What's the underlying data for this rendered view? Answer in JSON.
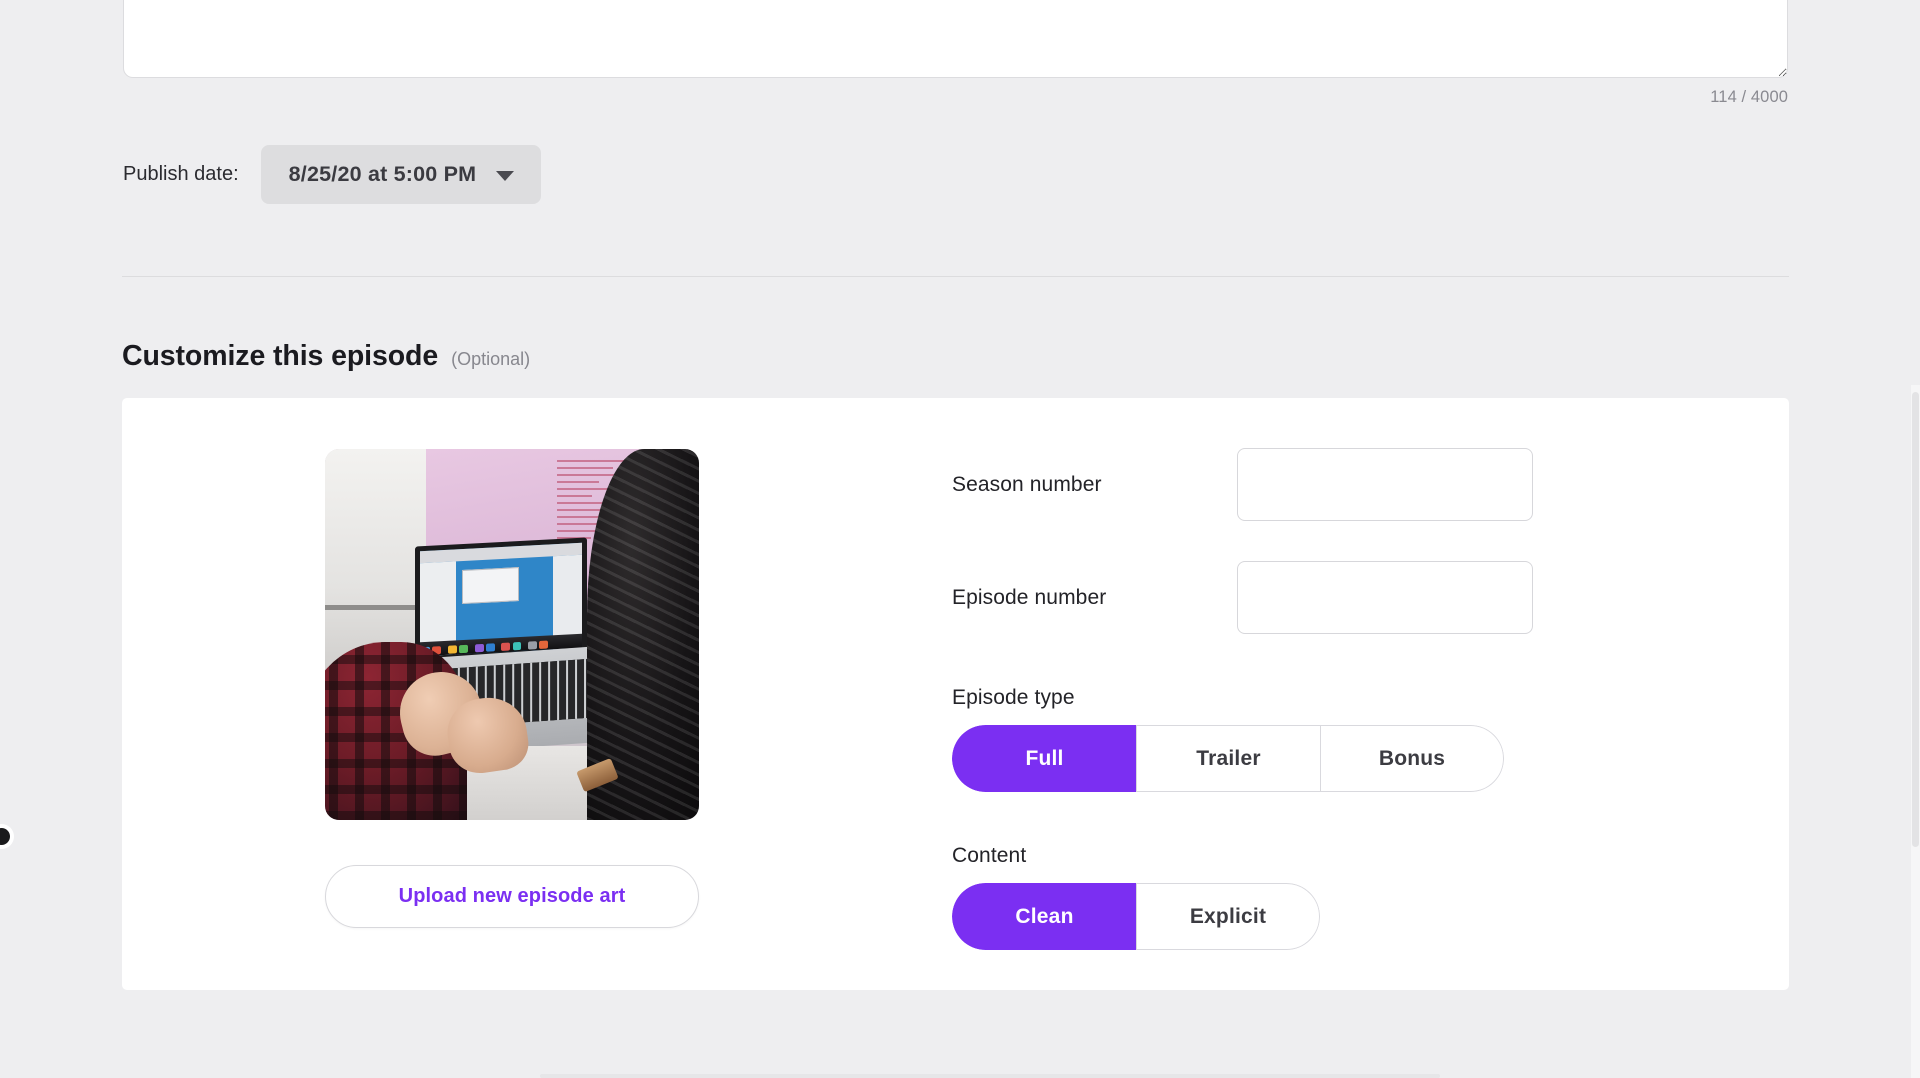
{
  "description_field": {
    "char_counter": "114 / 4000",
    "value": "",
    "placeholder": ""
  },
  "publish": {
    "label": "Publish date:",
    "date_value": "8/25/20 at 5:00 PM",
    "caret_icon": "chevron-down-icon"
  },
  "section": {
    "title": "Customize this episode",
    "optional_tag": "(Optional)"
  },
  "artwork": {
    "alt": "episode artwork photo of person typing on a laptop",
    "upload_button_label": "Upload new episode art"
  },
  "fields": [
    {
      "label": "Season number",
      "value": "",
      "placeholder": ""
    },
    {
      "label": "Episode number",
      "value": "",
      "placeholder": ""
    }
  ],
  "episode_type": {
    "label": "Episode type",
    "options": [
      {
        "label": "Full",
        "selected": true
      },
      {
        "label": "Trailer",
        "selected": false
      },
      {
        "label": "Bonus",
        "selected": false
      }
    ]
  },
  "content_rating": {
    "label": "Content",
    "options": [
      {
        "label": "Clean",
        "selected": true
      },
      {
        "label": "Explicit",
        "selected": false
      }
    ]
  },
  "colors": {
    "accent_purple": "#7b2ff2",
    "page_background": "#eeeef0",
    "card_background": "#ffffff",
    "text_primary": "#232328",
    "text_muted": "#8a8a91",
    "border": "#d9d9de"
  }
}
